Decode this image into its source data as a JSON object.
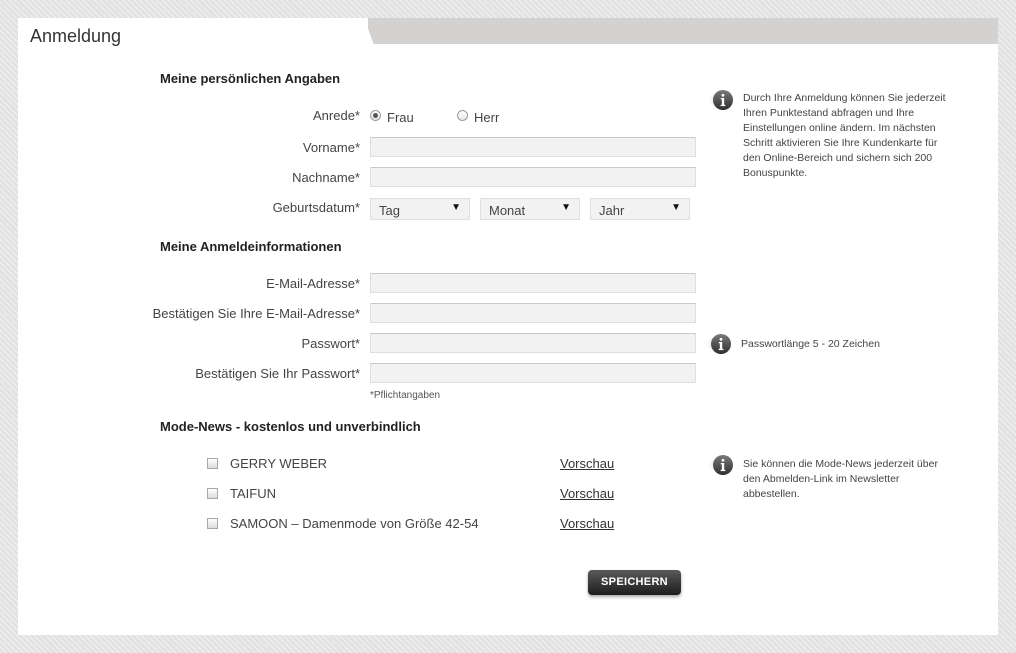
{
  "page_title": "Anmeldung",
  "personal": {
    "heading": "Meine persönlichen Angaben",
    "salutation_label": "Anrede*",
    "salutation_options": [
      "Frau",
      "Herr"
    ],
    "salutation_selected": "Frau",
    "firstname_label": "Vorname*",
    "lastname_label": "Nachname*",
    "birthdate_label": "Geburtsdatum*",
    "day": "Tag",
    "month": "Monat",
    "year": "Jahr",
    "info": "Durch Ihre Anmeldung können Sie jederzeit Ihren Punktestand abfragen und Ihre Einstellungen online ändern. Im nächsten Schritt aktivieren Sie Ihre Kundenkarte für den Online-Bereich und sichern sich 200 Bonuspunkte."
  },
  "login": {
    "heading": "Meine Anmeldeinformationen",
    "email_label": "E-Mail-Adresse*",
    "email_confirm_label": "Bestätigen Sie Ihre E-Mail-Adresse*",
    "password_label": "Passwort*",
    "password_confirm_label": "Bestätigen Sie Ihr Passwort*",
    "required_note": "*Pflichtangaben",
    "password_info": "Passwortlänge 5 - 20 Zeichen"
  },
  "newsletter": {
    "heading": "Mode-News - kostenlos und unverbindlich",
    "items": [
      {
        "label": "GERRY WEBER",
        "preview": "Vorschau"
      },
      {
        "label": "TAIFUN",
        "preview": "Vorschau"
      },
      {
        "label": "SAMOON – Damenmode von Größe 42-54",
        "preview": "Vorschau"
      }
    ],
    "info": "Sie können die Mode-News jederzeit über den Abmelden-Link im Newsletter abbestellen."
  },
  "save_button": "SPEICHERN",
  "icons": {
    "info": "info-icon",
    "select_arrow": "caret-down-icon"
  },
  "colors": {
    "panel": "#ffffff",
    "background": "#e2e2e2",
    "button": "#2a2a2a",
    "input": "#f2f2f2"
  }
}
